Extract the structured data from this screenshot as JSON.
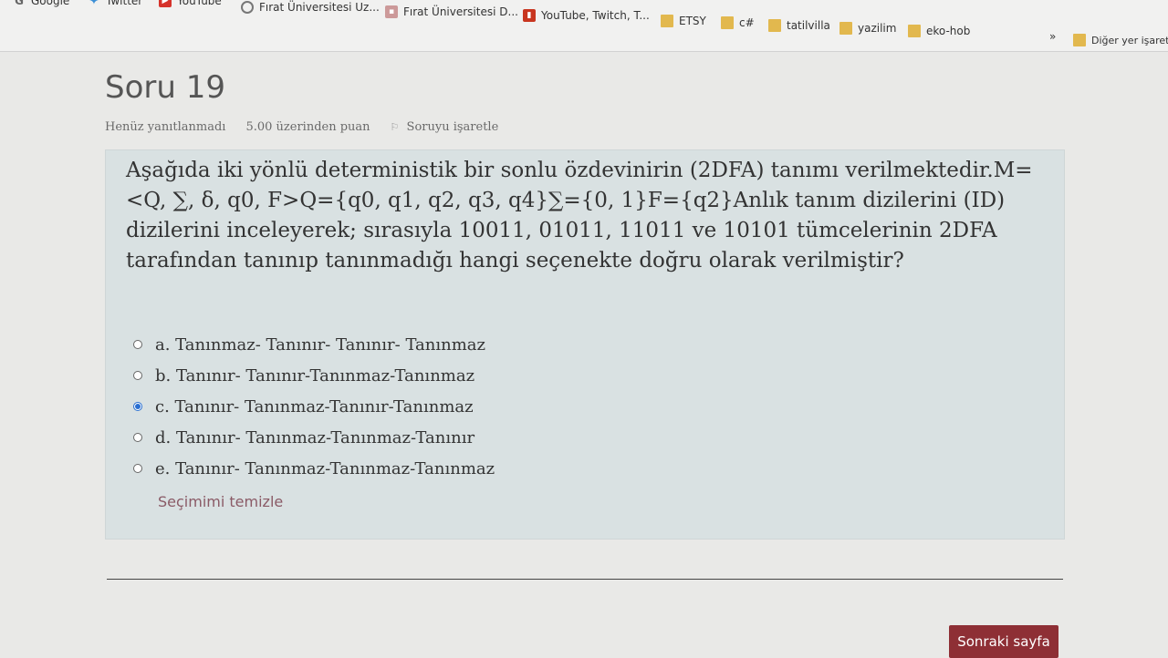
{
  "bookmarks": {
    "items": [
      {
        "label": "Google",
        "icon": "google-icon"
      },
      {
        "label": "Twitter",
        "icon": "twitter-icon"
      },
      {
        "label": "YouTube",
        "icon": "youtube-icon"
      },
      {
        "label": "Fırat Üniversitesi Uz...",
        "icon": "globe-icon"
      },
      {
        "label": "Fırat Üniversitesi D...",
        "icon": "university-icon"
      },
      {
        "label": "YouTube, Twitch, T...",
        "icon": "chart-icon"
      },
      {
        "label": "ETSY",
        "icon": "folder-icon"
      },
      {
        "label": "c#",
        "icon": "folder-icon"
      },
      {
        "label": "tatilvilla",
        "icon": "folder-icon"
      },
      {
        "label": "yazilim",
        "icon": "folder-icon"
      },
      {
        "label": "eko-hob",
        "icon": "folder-icon"
      }
    ],
    "overflow": "»",
    "other": "Diğer yer işaretle"
  },
  "question": {
    "title": "Soru 19",
    "status": "Henüz yanıtlanmadı",
    "points": "5.00 üzerinden puan",
    "flag_label": "Soruyu işaretle",
    "text": "Aşağıda iki yönlü deterministik bir sonlu özdevinirin (2DFA) tanımı verilmektedir.M=<Q, ∑, δ, q0, F>Q={q0, q1, q2, q3, q4}∑={0, 1}F={q2}Anlık tanım dizilerini (ID) dizilerini inceleyerek; sırasıyla 10011, 01011, 11011 ve 10101 tümcelerinin 2DFA tarafından tanınıp tanınmadığı hangi seçenekte doğru olarak verilmiştir?",
    "options": [
      {
        "label": "a. Tanınmaz- Tanınır- Tanınır- Tanınmaz",
        "selected": false
      },
      {
        "label": "b. Tanınır- Tanınır-Tanınmaz-Tanınmaz",
        "selected": false
      },
      {
        "label": "c. Tanınır- Tanınmaz-Tanınır-Tanınmaz",
        "selected": true
      },
      {
        "label": "d. Tanınır- Tanınmaz-Tanınmaz-Tanınır",
        "selected": false
      },
      {
        "label": "e. Tanınır- Tanınmaz-Tanınmaz-Tanınmaz",
        "selected": false
      }
    ],
    "clear_label": "Seçimimi temizle"
  },
  "footer": {
    "next_label": "Sonraki sayfa"
  },
  "colors": {
    "question_bg": "#d9e1e2",
    "next_button": "#8e2f35",
    "radio_selected": "#2a6fd1",
    "clear_link": "#8a5a66"
  }
}
